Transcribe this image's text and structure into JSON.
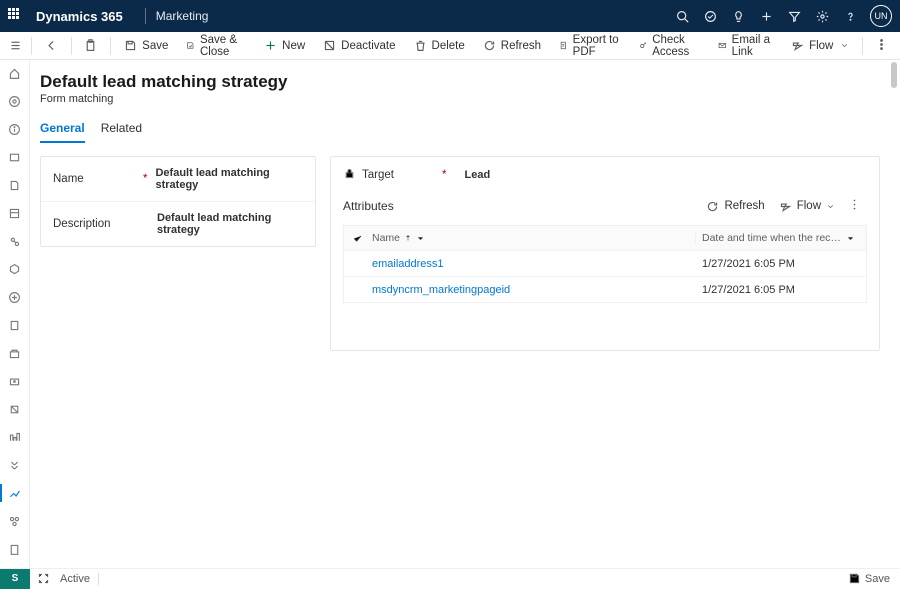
{
  "topnav": {
    "brand": "Dynamics 365",
    "module": "Marketing",
    "avatar": "UN"
  },
  "commands": {
    "save": "Save",
    "save_close": "Save & Close",
    "new": "New",
    "deactivate": "Deactivate",
    "delete": "Delete",
    "refresh": "Refresh",
    "export_pdf": "Export to PDF",
    "check_access": "Check Access",
    "email_link": "Email a Link",
    "flow": "Flow"
  },
  "page": {
    "title": "Default lead matching strategy",
    "subtitle": "Form matching"
  },
  "tabs": {
    "general": "General",
    "related": "Related"
  },
  "form": {
    "name_label": "Name",
    "name_value": "Default lead matching strategy",
    "desc_label": "Description",
    "desc_value": "Default lead matching strategy",
    "target_label": "Target",
    "target_value": "Lead"
  },
  "attributes": {
    "title": "Attributes",
    "refresh": "Refresh",
    "flow": "Flow",
    "col_name": "Name",
    "col_date": "Date and time when the record was created",
    "rows": [
      {
        "name": "emailaddress1",
        "date": "1/27/2021 6:05 PM"
      },
      {
        "name": "msdyncrm_marketingpageid",
        "date": "1/27/2021 6:05 PM"
      }
    ]
  },
  "status": {
    "box": "S",
    "active": "Active",
    "save": "Save"
  }
}
